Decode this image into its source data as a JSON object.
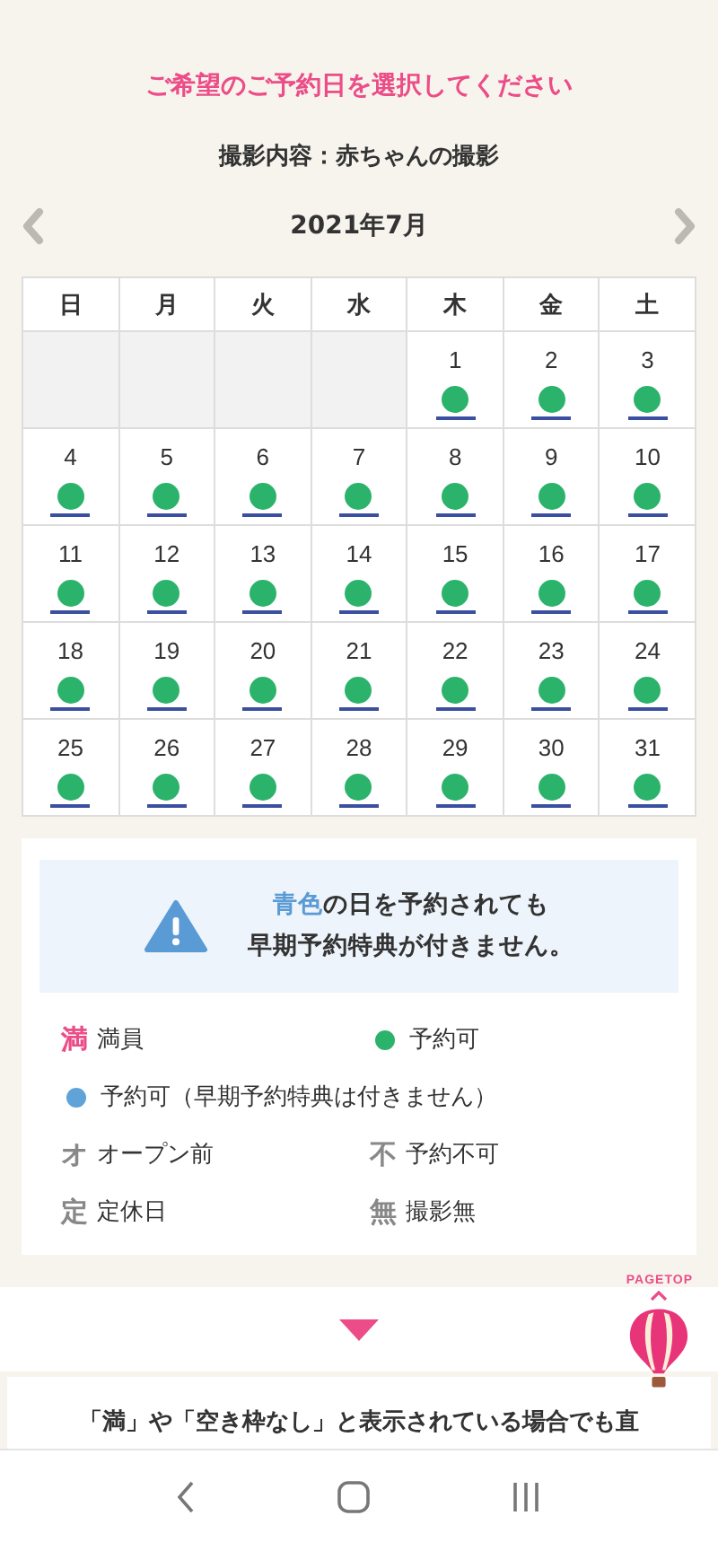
{
  "heading": "ご希望のご予約日を選択してください",
  "subtitle": "撮影内容：赤ちゃんの撮影",
  "month": "2021年7月",
  "weekdays": [
    "日",
    "月",
    "火",
    "水",
    "木",
    "金",
    "土"
  ],
  "weeks": [
    [
      {
        "kind": "empty"
      },
      {
        "kind": "empty"
      },
      {
        "kind": "empty"
      },
      {
        "kind": "empty"
      },
      {
        "kind": "available",
        "day": "1"
      },
      {
        "kind": "available",
        "day": "2"
      },
      {
        "kind": "available",
        "day": "3"
      }
    ],
    [
      {
        "kind": "available",
        "day": "4"
      },
      {
        "kind": "available",
        "day": "5"
      },
      {
        "kind": "available",
        "day": "6"
      },
      {
        "kind": "available",
        "day": "7"
      },
      {
        "kind": "available",
        "day": "8"
      },
      {
        "kind": "available",
        "day": "9"
      },
      {
        "kind": "available",
        "day": "10"
      }
    ],
    [
      {
        "kind": "available",
        "day": "11"
      },
      {
        "kind": "available",
        "day": "12"
      },
      {
        "kind": "available",
        "day": "13"
      },
      {
        "kind": "available",
        "day": "14"
      },
      {
        "kind": "available",
        "day": "15"
      },
      {
        "kind": "available",
        "day": "16"
      },
      {
        "kind": "available",
        "day": "17"
      }
    ],
    [
      {
        "kind": "available",
        "day": "18"
      },
      {
        "kind": "available",
        "day": "19"
      },
      {
        "kind": "available",
        "day": "20"
      },
      {
        "kind": "available",
        "day": "21"
      },
      {
        "kind": "available",
        "day": "22"
      },
      {
        "kind": "available",
        "day": "23"
      },
      {
        "kind": "available",
        "day": "24"
      }
    ],
    [
      {
        "kind": "available",
        "day": "25"
      },
      {
        "kind": "available",
        "day": "26"
      },
      {
        "kind": "available",
        "day": "27"
      },
      {
        "kind": "available",
        "day": "28"
      },
      {
        "kind": "available",
        "day": "29"
      },
      {
        "kind": "available",
        "day": "30"
      },
      {
        "kind": "available",
        "day": "31"
      }
    ]
  ],
  "notice": {
    "highlight": "青色",
    "line1": "の日を予約されても",
    "line2": "早期予約特典が付きません。"
  },
  "legend": [
    {
      "kind": "mark",
      "mark": "満",
      "label": "満員",
      "color": "#ec4c87"
    },
    {
      "kind": "dot",
      "label": "予約可",
      "color": "#2bb36b"
    },
    {
      "kind": "dot",
      "label": "予約可（早期予約特典は付きません）",
      "color": "#5fa3d9",
      "wide": true
    },
    {
      "kind": "mark",
      "mark": "オ",
      "label": "オープン前",
      "color": "#888888"
    },
    {
      "kind": "mark",
      "mark": "不",
      "label": "予約不可",
      "color": "#888888"
    },
    {
      "kind": "mark",
      "mark": "定",
      "label": "定休日",
      "color": "#888888"
    },
    {
      "kind": "mark",
      "mark": "無",
      "label": "撮影無",
      "color": "#888888"
    }
  ],
  "pagetop": "PAGETOP",
  "note": "「満」や「空き枠なし」と表示されている場合でも直"
}
